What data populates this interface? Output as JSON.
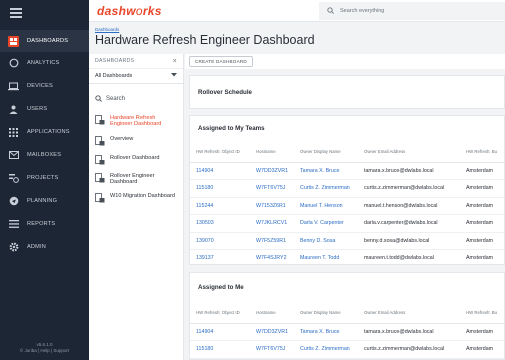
{
  "app": {
    "logo_main": "dashw",
    "logo_light": "o",
    "logo_rest": "rks"
  },
  "search": {
    "placeholder": "Search everything"
  },
  "sidebar": {
    "items": [
      {
        "label": "DASHBOARDS",
        "icon": "dashboard-icon"
      },
      {
        "label": "ANALYTICS",
        "icon": "analytics-icon"
      },
      {
        "label": "DEVICES",
        "icon": "laptop-icon"
      },
      {
        "label": "USERS",
        "icon": "user-icon"
      },
      {
        "label": "APPLICATIONS",
        "icon": "grid-icon"
      },
      {
        "label": "MAILBOXES",
        "icon": "mail-icon"
      },
      {
        "label": "PROJECTS",
        "icon": "projects-icon"
      },
      {
        "label": "PLANNING",
        "icon": "planning-icon"
      },
      {
        "label": "REPORTS",
        "icon": "reports-icon"
      },
      {
        "label": "ADMIN",
        "icon": "gear-icon"
      }
    ],
    "version": "v5.6.1.0",
    "footer": "© Juriba | Help | Support"
  },
  "header": {
    "breadcrumb": "Dashboards",
    "title": "Hardware Refresh Engineer Dashboard"
  },
  "dashboards_panel": {
    "heading": "DASHBOARDS",
    "select_value": "All Dashboards",
    "search_label": "Search",
    "items": [
      {
        "label": "Hardware Refresh Engineer Dashboard"
      },
      {
        "label": "Overview"
      },
      {
        "label": "Rollover Dashboard"
      },
      {
        "label": "Rollover Engineer Dashboard"
      },
      {
        "label": "W10 Migration Dashboard"
      }
    ]
  },
  "toolbar": {
    "create_label": "CREATE DASHBOARD"
  },
  "rollover": {
    "title": "Rollover Schedule"
  },
  "columns": [
    "HW Refresh: Object ID",
    "Hostname",
    "Owner Display Name",
    "Owner Email Address",
    "HW Refresh: Bu"
  ],
  "teams": {
    "title": "Assigned to My Teams",
    "rows": [
      [
        "114904",
        "W7DD3ZVR1",
        "Tamara X. Bruce",
        "tamara.x.bruce@dwlabs.local",
        "Amsterdam"
      ],
      [
        "115180",
        "W7FT6V75J",
        "Curtis Z. Zimmerman",
        "curtis.z.zimmerman@dwlabs.local",
        "Amsterdam"
      ],
      [
        "115244",
        "W7153Z6R1",
        "Manuel T. Henson",
        "manuel.t.henson@dwlabs.local",
        "Amsterdam"
      ],
      [
        "130503",
        "W7JKLRCV1",
        "Darla V. Carpenter",
        "darla.v.carpenter@dwlabs.local",
        "Amsterdam"
      ],
      [
        "139070",
        "W7F5Z59R1",
        "Benny D. Sosa",
        "benny.d.sosa@dwlabs.local",
        "Amsterdam"
      ],
      [
        "139137",
        "W7F4SJRY2",
        "Maureen T. Todd",
        "maureen.t.todd@dwlabs.local",
        "Amsterdam"
      ]
    ]
  },
  "me": {
    "title": "Assigned to Me",
    "rows": [
      [
        "114904",
        "W7DD3ZVR1",
        "Tamara X. Bruce",
        "tamara.x.bruce@dwlabs.local",
        "Amsterdam"
      ],
      [
        "115180",
        "W7FT6V75J",
        "Curtis Z. Zimmerman",
        "curtis.z.zimmerman@dwlabs.local",
        "Amsterdam"
      ]
    ]
  },
  "colors": {
    "brand": "#e8462a",
    "sidebar_bg": "#1d2634",
    "link": "#2b6cc4"
  }
}
